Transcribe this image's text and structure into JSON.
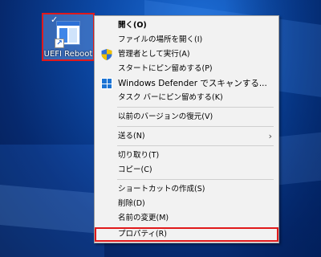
{
  "desktop": {
    "icon_label": "UEFI Reboot"
  },
  "context_menu": {
    "items": [
      {
        "label": "開く(O)"
      },
      {
        "label": "ファイルの場所を開く(I)"
      },
      {
        "label": "管理者として実行(A)"
      },
      {
        "label": "スタートにピン留めする(P)"
      },
      {
        "label": "Windows Defender でスキャンする..."
      },
      {
        "label": "タスク バーにピン留めする(K)"
      },
      {
        "label": "以前のバージョンの復元(V)"
      },
      {
        "label": "送る(N)"
      },
      {
        "label": "切り取り(T)"
      },
      {
        "label": "コピー(C)"
      },
      {
        "label": "ショートカットの作成(S)"
      },
      {
        "label": "削除(D)"
      },
      {
        "label": "名前の変更(M)"
      },
      {
        "label": "プロパティ(R)"
      }
    ]
  },
  "colors": {
    "highlight": "#e0191b",
    "menu_bg": "#f2f2f2"
  }
}
